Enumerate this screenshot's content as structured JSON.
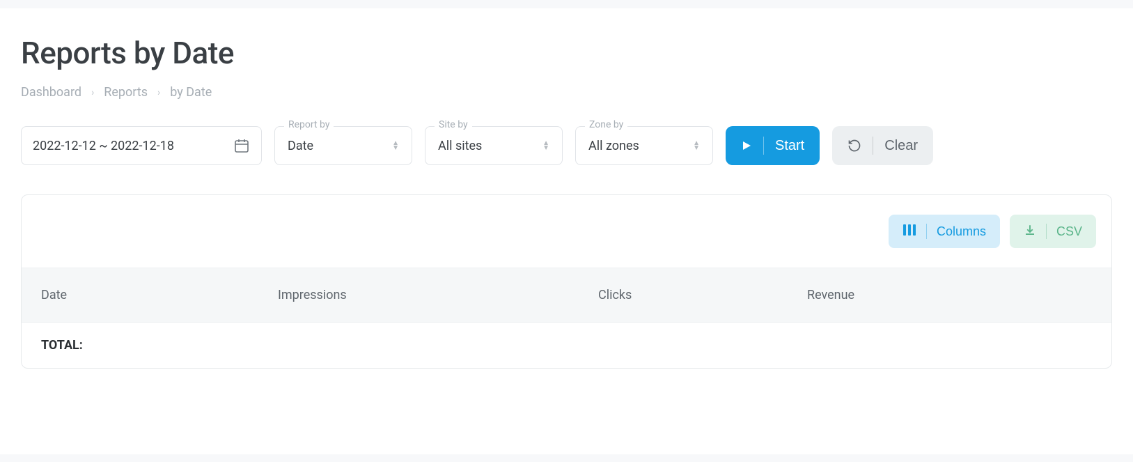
{
  "header": {
    "title": "Reports by Date"
  },
  "breadcrumb": {
    "items": [
      "Dashboard",
      "Reports",
      "by Date"
    ]
  },
  "filters": {
    "date_range": "2022-12-12 ~ 2022-12-18",
    "report_by": {
      "label": "Report by",
      "value": "Date"
    },
    "site_by": {
      "label": "Site by",
      "value": "All sites"
    },
    "zone_by": {
      "label": "Zone by",
      "value": "All zones"
    }
  },
  "actions": {
    "start": "Start",
    "clear": "Clear"
  },
  "panel": {
    "columns_btn": "Columns",
    "csv_btn": "CSV"
  },
  "table": {
    "headers": {
      "date": "Date",
      "impressions": "Impressions",
      "clicks": "Clicks",
      "revenue": "Revenue"
    },
    "total_label": "TOTAL:"
  }
}
